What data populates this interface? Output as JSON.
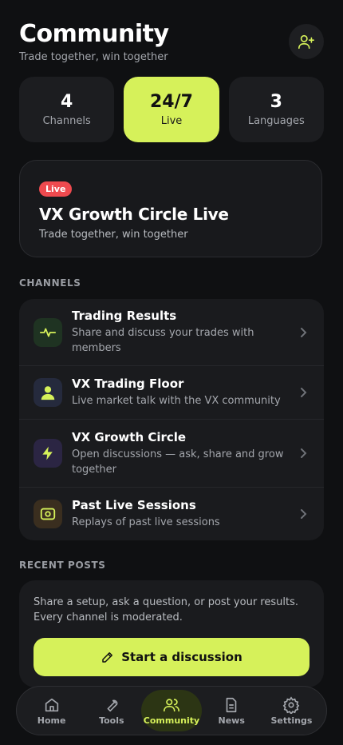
{
  "header": {
    "title": "Community",
    "subtitle": "Trade together, win together"
  },
  "stats": [
    {
      "value": "4",
      "label": "Channels"
    },
    {
      "value": "24/7",
      "label": "Live"
    },
    {
      "value": "3",
      "label": "Languages"
    }
  ],
  "live_card": {
    "badge": "Live",
    "title": "VX Growth Circle Live",
    "subtitle": "Trade together, win together"
  },
  "channels_section": {
    "label": "CHANNELS",
    "items": [
      {
        "title": "Trading Results",
        "desc": "Share and discuss your trades with members",
        "icon": "pulse-icon"
      },
      {
        "title": "VX Trading Floor",
        "desc": "Live market talk with the VX community",
        "icon": "user-icon"
      },
      {
        "title": "VX Growth Circle",
        "desc": "Open discussions — ask, share and grow together",
        "icon": "lightning-icon"
      },
      {
        "title": "Past Live Sessions",
        "desc": "Replays of past live sessions",
        "icon": "video-icon"
      }
    ]
  },
  "recent_posts": {
    "label": "RECENT POSTS",
    "text": "Share a setup, ask a question, or post your results. Every channel is moderated.",
    "button": "Start a discussion"
  },
  "tabbar": [
    {
      "label": "Home",
      "icon": "home-icon"
    },
    {
      "label": "Tools",
      "icon": "wrench-icon"
    },
    {
      "label": "Community",
      "icon": "users-icon",
      "active": true
    },
    {
      "label": "News",
      "icon": "document-icon"
    },
    {
      "label": "Settings",
      "icon": "gear-icon"
    }
  ],
  "colors": {
    "accent": "#d6f15a",
    "live_red": "#ef4a4f",
    "background": "#0f1012",
    "card": "#1a1b1e"
  }
}
